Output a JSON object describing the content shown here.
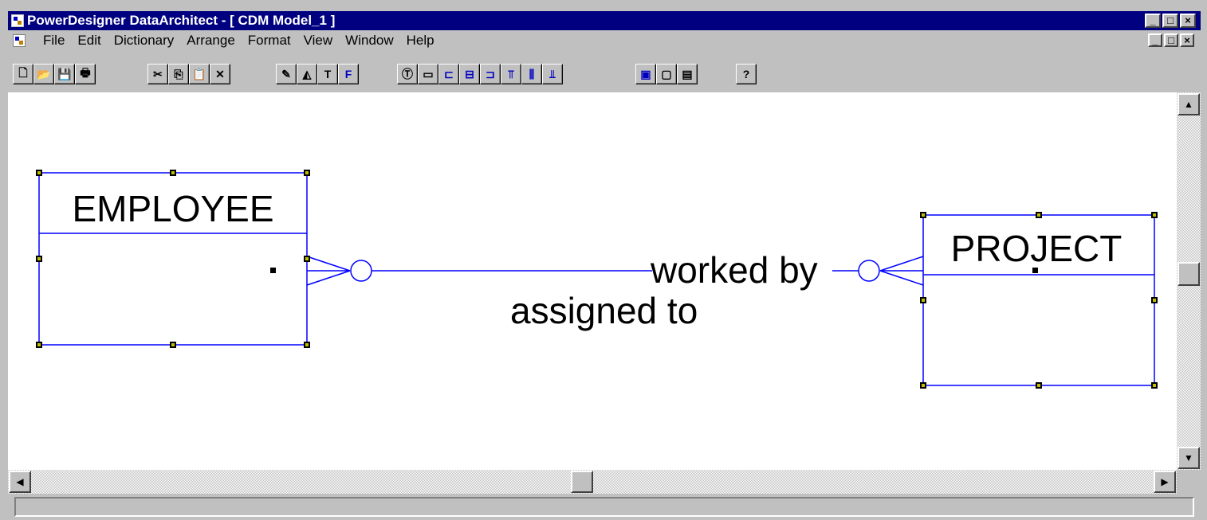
{
  "window": {
    "title": "PowerDesigner DataArchitect - [ CDM Model_1 ]",
    "controls": {
      "minimize": "_",
      "maximize": "□",
      "close": "×"
    }
  },
  "menu": {
    "items": [
      "File",
      "Edit",
      "Dictionary",
      "Arrange",
      "Format",
      "View",
      "Window",
      "Help"
    ]
  },
  "toolbar": {
    "groups": [
      [
        "new-icon",
        "open-icon",
        "save-icon",
        "print-icon"
      ],
      [
        "cut-icon",
        "copy-icon",
        "paste-icon",
        "delete-icon"
      ],
      [
        "pencil-icon",
        "fill-icon",
        "text-color-icon",
        "font-icon"
      ],
      [
        "text-tool-icon",
        "rectangle-icon",
        "align-left-icon",
        "align-center-icon",
        "align-right-icon",
        "align-top-icon",
        "align-middle-icon",
        "align-bottom-icon"
      ],
      [
        "display-model-icon",
        "display-entity-icon",
        "display-attrs-icon"
      ],
      [
        "help-icon"
      ]
    ]
  },
  "diagram": {
    "entities": [
      {
        "id": "employee",
        "name": "EMPLOYEE"
      },
      {
        "id": "project",
        "name": "PROJECT"
      }
    ],
    "relationship": {
      "role_to_project": "worked by",
      "role_to_employee": "assigned to"
    },
    "colors": {
      "entity_border": "#0000ff",
      "handle": "#000000",
      "handle_center": "#c0c000"
    }
  },
  "statusbar": {
    "text": ""
  }
}
